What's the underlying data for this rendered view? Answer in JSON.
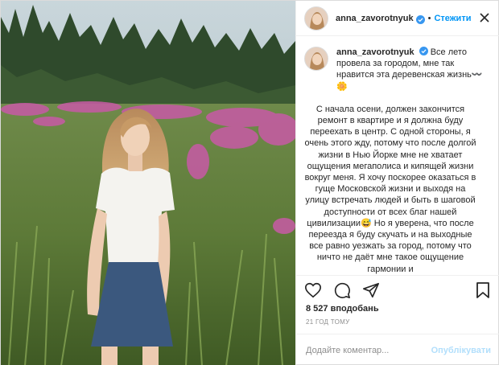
{
  "post": {
    "username": "anna_zavorotnyuk",
    "follow_label": "Стежити",
    "separator": "•",
    "caption_first": "Все лето провела за городом, мне так нравится эта деревенская жизнь〰️🌼",
    "caption_second": "С начала осени, должен закончится ремонт в квартире и я должна буду переехать в центр. С одной стороны, я очень этого жду, потому что после долгой жизни в Нью Йорке мне не хватает ощущения мегаполиса и кипящей жизни вокруг меня. Я хочу поскорее оказаться в гуще Московской жизни и выходя на улицу встречать людей и быть в шаговой доступности от всех благ нашей цивилизации😅 Но я уверена, что после переезда я буду скучать и на выходные все равно уезжать за город, потому что ничто не даёт мне такое ощущение гармонии и",
    "likes": "8 527 вподобань",
    "time": "21 год тому",
    "comment_placeholder": "Додайте коментар...",
    "publish_label": "Опублікувати"
  },
  "icons": {
    "verified": "verified-badge-icon",
    "more": "more-options-icon",
    "like": "heart-icon",
    "comment": "comment-icon",
    "share": "share-icon",
    "save": "bookmark-icon"
  },
  "colors": {
    "link_blue": "#0095f6",
    "publish_disabled": "#b2dffc",
    "meta_gray": "#8e8e8e",
    "border": "#dbdbdb"
  }
}
